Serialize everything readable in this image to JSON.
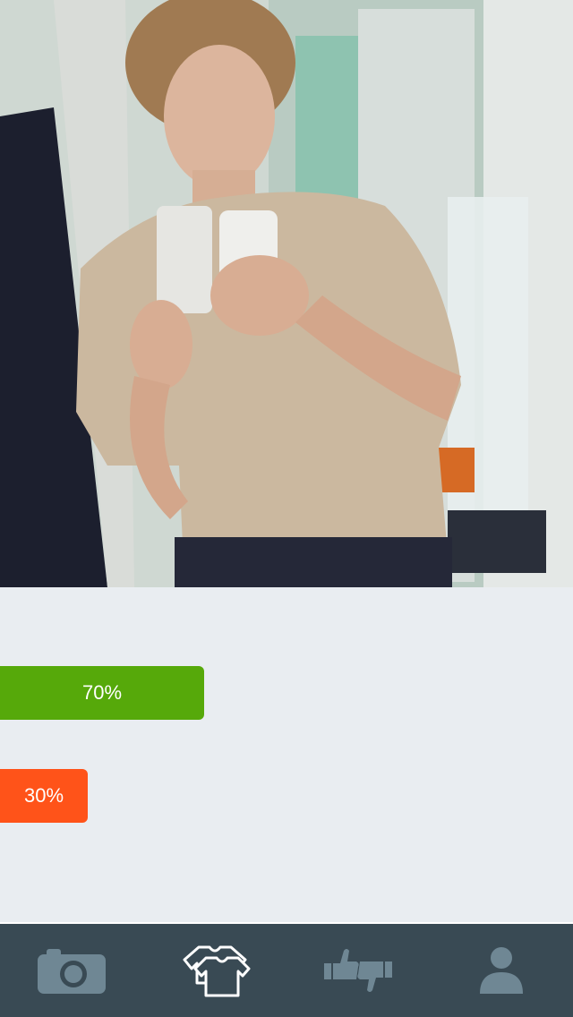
{
  "photo": {
    "description_icon": "photo-of-outfit"
  },
  "vote_results": {
    "yes": {
      "label": "70%",
      "fraction": 0.7,
      "color": "#56a90a"
    },
    "no": {
      "label": "30%",
      "fraction": 0.3,
      "color": "#ff5319"
    }
  },
  "tabbar": {
    "background": "#394a54",
    "items": [
      {
        "icon": "camera-icon",
        "active": false
      },
      {
        "icon": "clothes-icon",
        "active": true
      },
      {
        "icon": "thumbs-up-down-icon",
        "active": false
      },
      {
        "icon": "profile-icon",
        "active": false
      }
    ]
  }
}
